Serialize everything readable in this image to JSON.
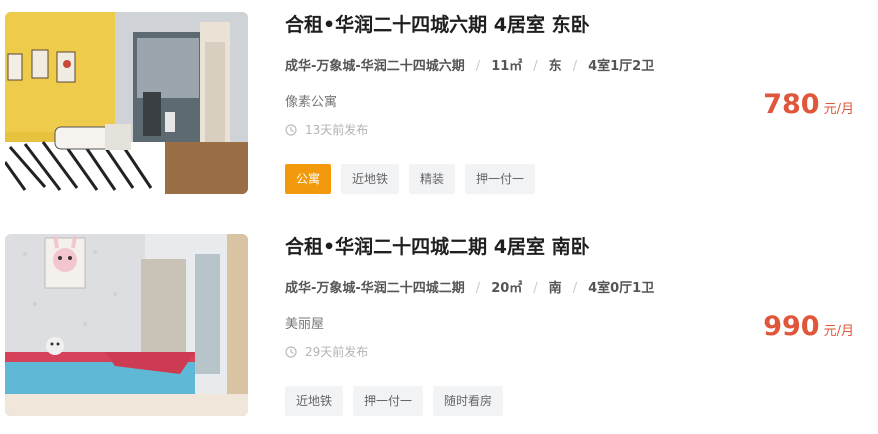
{
  "listings": [
    {
      "title": "合租•华润二十四城六期 4居室 东卧",
      "location": "成华-万象城-华润二十四城六期",
      "area": "11㎡",
      "orientation": "东",
      "layout": "4室1厅2卫",
      "brand": "像素公寓",
      "posted": "13天前发布",
      "price": "780",
      "price_unit": "元/月",
      "tags": [
        {
          "label": "公寓",
          "accent": true
        },
        {
          "label": "近地铁",
          "accent": false
        },
        {
          "label": "精装",
          "accent": false
        },
        {
          "label": "押一付一",
          "accent": false
        }
      ],
      "photo_icon": "bedroom-photo"
    },
    {
      "title": "合租•华润二十四城二期 4居室 南卧",
      "location": "成华-万象城-华润二十四城二期",
      "area": "20㎡",
      "orientation": "南",
      "layout": "4室0厅1卫",
      "brand": "美丽屋",
      "posted": "29天前发布",
      "price": "990",
      "price_unit": "元/月",
      "tags": [
        {
          "label": "近地铁",
          "accent": false
        },
        {
          "label": "押一付一",
          "accent": false
        },
        {
          "label": "随时看房",
          "accent": false
        }
      ],
      "photo_icon": "bedroom-photo"
    }
  ],
  "colors": {
    "price": "#e0563a",
    "accent_tag": "#f29a0b",
    "tag_bg": "#f2f3f5",
    "title": "#1f1f1f"
  },
  "icons": {
    "posted": "clock-icon"
  }
}
